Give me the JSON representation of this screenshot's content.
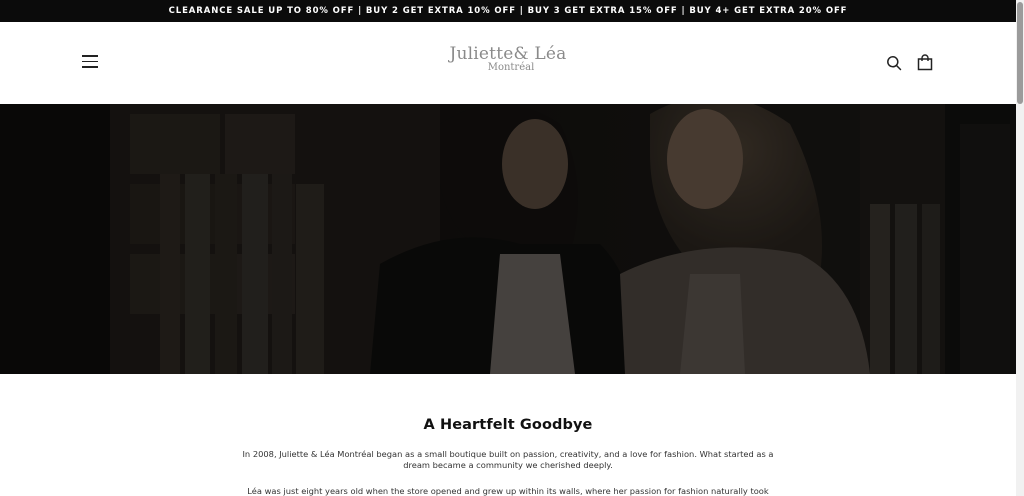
{
  "announcement": {
    "text": "CLEARANCE SALE UP TO 80% OFF | BUY 2 GET EXTRA 10% OFF | BUY 3 GET EXTRA 15% OFF | BUY 4+ GET EXTRA 20% OFF"
  },
  "header": {
    "logo_main": "Juliette& Léa",
    "logo_sub": "Montréal",
    "icons": {
      "menu": "hamburger-menu-icon",
      "search": "search-icon",
      "cart": "shopping-bag-icon"
    }
  },
  "content": {
    "title": "A Heartfelt Goodbye",
    "paragraph1": "In 2008, Juliette & Léa Montréal began as a small boutique built on passion, creativity, and a love for fashion. What started as a dream became a community we cherished deeply.",
    "paragraph2": "Léa was just eight years old when the store opened and grew up within its walls, where her passion for fashion naturally took shape."
  },
  "colors": {
    "announcement_bg": "#0b0b0b",
    "logo": "#8a8a8a",
    "hero_overlay": "#141210"
  }
}
